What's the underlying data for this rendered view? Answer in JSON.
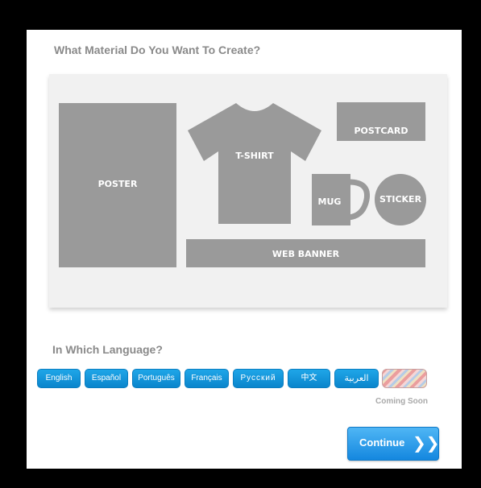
{
  "material_section": {
    "heading": "What Material Do You Want To Create?",
    "items": {
      "poster": "POSTER",
      "tshirt": "T-SHIRT",
      "postcard": "POSTCARD",
      "mug": "MUG",
      "sticker": "STICKER",
      "web_banner": "WEB BANNER"
    }
  },
  "language_section": {
    "heading": "In Which Language?",
    "languages": [
      "English",
      "Español",
      "Português",
      "Français",
      "Русский",
      "中文",
      "العربية"
    ],
    "coming_soon": "Coming Soon"
  },
  "continue_button": {
    "label": "Continue",
    "icon": "double-chevron-right-icon",
    "glyph": "❯❯"
  },
  "colors": {
    "item_gray": "#9a9a9a",
    "canvas_bg": "#f1f1f1",
    "accent_blue": "#1487df"
  }
}
